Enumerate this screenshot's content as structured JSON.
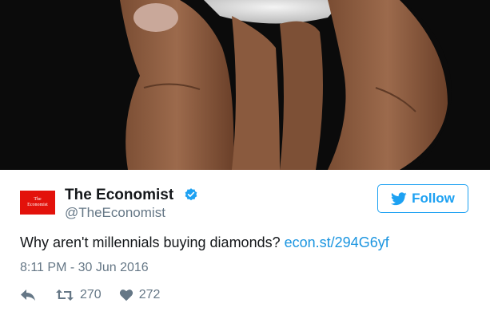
{
  "account": {
    "name": "The Economist",
    "handle": "@TheEconomist",
    "avatar_text_line1": "The",
    "avatar_text_line2": "Economist"
  },
  "follow_label": "Follow",
  "tweet": {
    "text": "Why aren't millennials buying diamonds?",
    "link": "econ.st/294G6yf",
    "timestamp": "8:11 PM - 30 Jun 2016"
  },
  "stats": {
    "retweets": "270",
    "likes": "272"
  },
  "colors": {
    "accent": "#1da1f2",
    "link": "#1b95e0",
    "brand_red": "#e3120b",
    "muted": "#657786"
  },
  "icons": [
    "verified-badge-icon",
    "twitter-bird-icon",
    "reply-icon",
    "retweet-icon",
    "heart-icon"
  ]
}
